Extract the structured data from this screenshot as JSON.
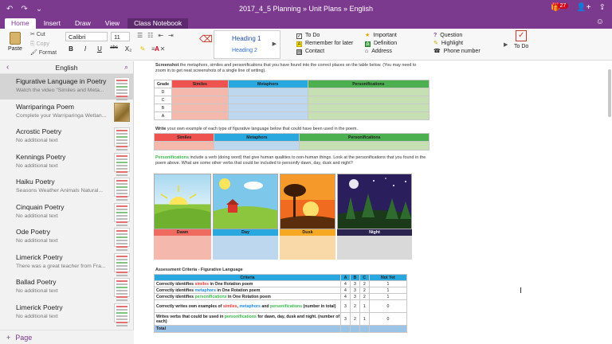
{
  "window": {
    "title": "2017_4_5 Planning » Unit Plans » English",
    "notification_count": "27"
  },
  "ribbon_tabs": [
    "Home",
    "Insert",
    "Draw",
    "View",
    "Class Notebook"
  ],
  "ribbon": {
    "paste": "Paste",
    "cut": "Cut",
    "copy": "Copy",
    "format": "Format",
    "font_name": "Calibri",
    "font_size": "11",
    "bold": "B",
    "italic": "I",
    "underline": "U",
    "strike": "abc",
    "subscript": "X₂",
    "styles": {
      "heading1": "Heading 1",
      "heading2": "Heading 2"
    },
    "tags": {
      "col1": [
        "To Do",
        "Remember for later",
        "Contact"
      ],
      "col2": [
        "Important",
        "Definition",
        "Address"
      ],
      "col3": [
        "Question",
        "Highlight",
        "Phone number"
      ]
    },
    "todo_button": "To Do"
  },
  "sidebar": {
    "section_title": "English",
    "pages": [
      {
        "title": "Figurative Language in Poetry",
        "subtitle": "Watch the video \"Similes and Meta..."
      },
      {
        "title": "Warriparinga Poem",
        "subtitle": "Complete your Warriparinga Wetlan..."
      },
      {
        "title": "Acrostic Poetry",
        "subtitle": "No additional text"
      },
      {
        "title": "Kennings Poetry",
        "subtitle": "No additional text"
      },
      {
        "title": "Haiku Poetry",
        "subtitle": "Seasons  Weather  Animals  Natural..."
      },
      {
        "title": "Cinquain Poetry",
        "subtitle": "No additional text"
      },
      {
        "title": "Ode Poetry",
        "subtitle": "No additional text"
      },
      {
        "title": "Limerick Poetry",
        "subtitle": "There was a great teacher from Fra..."
      },
      {
        "title": "Ballad Poetry",
        "subtitle": "No additional text"
      },
      {
        "title": "Limerick Poetry",
        "subtitle": "No additional text"
      }
    ],
    "add_page": "Page"
  },
  "page": {
    "intro_bold": "Screenshot",
    "intro_rest": " the metaphors, similes and personifications that you have found into the correct places on the table below. (You may need to zoom in to get neat screenshots of a single line of writing).",
    "table1": {
      "headers": [
        "Grade",
        "Similes",
        "Metaphors",
        "Personifications"
      ],
      "grades": [
        "D",
        "C",
        "B",
        "A"
      ]
    },
    "write_bold": "Write",
    "write_rest": " your own example of each type of figurative language below that could have been used in the poem.",
    "table2": {
      "headers": [
        "Similes",
        "Metaphors",
        "Personifications"
      ]
    },
    "pers_word": "Personifications",
    "pers_rest": " include a verb (doing word) that give human qualities to non-human things.  Look at the personifications that you found in the poem above.  What are some other verbs that could be included to personify dawn, day, dusk and night?",
    "images": [
      "Dawn",
      "Day",
      "Dusk",
      "Night"
    ],
    "criteria": {
      "heading": "Assessment Criteria - Figurative Language",
      "columns": [
        "Criteria",
        "A",
        "B",
        "C",
        "Not Yet"
      ],
      "rows": [
        {
          "pre": "Correctly identifies ",
          "hl": "similes",
          "hlc": "sr",
          "post": " in One Rotation poem",
          "a": "4",
          "b": "3",
          "c": "2",
          "n": "1"
        },
        {
          "pre": "Correctly identifies ",
          "hl": "metaphors",
          "hlc": "sb",
          "post": " in One Rotation poem",
          "a": "4",
          "b": "3",
          "c": "2",
          "n": "1"
        },
        {
          "pre": "Correctly identifies ",
          "hl": "personifications",
          "hlc": "sg",
          "post": " in One Rotation poem",
          "a": "4",
          "b": "3",
          "c": "2",
          "n": "1"
        }
      ],
      "row4": {
        "text": "Correctly writes own examples of similes, metaphors and personifications (number in total)",
        "a": "3",
        "b": "2",
        "c": "1",
        "n": "0"
      },
      "row5": {
        "text": "Writes verbs that could be used in personifications for dawn, day, dusk and night. (number of each)",
        "a": "3",
        "b": "2",
        "c": "1",
        "n": "0"
      },
      "total": "Total"
    }
  }
}
